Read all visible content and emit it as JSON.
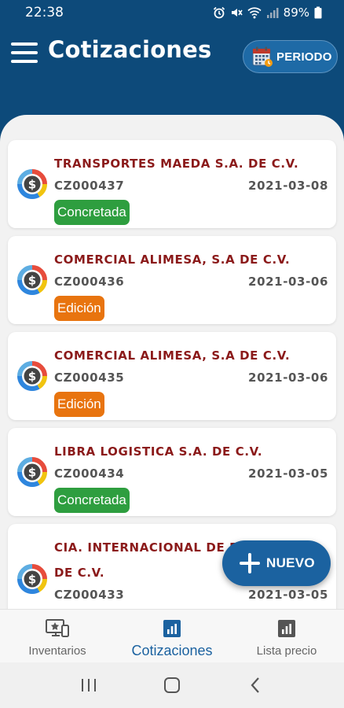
{
  "status_bar": {
    "time": "22:38",
    "battery": "89%"
  },
  "app_bar": {
    "title": "Cotizaciones",
    "periodo_label": "PERIODO"
  },
  "quotes": [
    {
      "name": "TRANSPORTES MAEDA S.A. DE C.V.",
      "code": "CZ000437",
      "date": "2021-03-08",
      "status": "Concretada",
      "status_color": "#2e9e3f"
    },
    {
      "name": "COMERCIAL ALIMESA, S.A DE C.V.",
      "code": "CZ000436",
      "date": "2021-03-06",
      "status": "Edición",
      "status_color": "#e8740f"
    },
    {
      "name": "COMERCIAL ALIMESA, S.A DE C.V.",
      "code": "CZ000435",
      "date": "2021-03-06",
      "status": "Edición",
      "status_color": "#e8740f"
    },
    {
      "name": "LIBRA LOGISTICA S.A. DE C.V.",
      "code": "CZ000434",
      "date": "2021-03-05",
      "status": "Concretada",
      "status_color": "#2e9e3f"
    },
    {
      "name": "CIA. INTERNACIONAL DE FLETES S.A. DE C.V.",
      "code": "CZ000433",
      "date": "2021-03-05",
      "status": "",
      "status_color": ""
    }
  ],
  "fab": {
    "label": "NUEVO"
  },
  "bottom_nav": {
    "items": [
      {
        "label": "Inventarios",
        "icon": "inventory-icon"
      },
      {
        "label": "Cotizaciones",
        "icon": "bar-chart-icon",
        "active": true
      },
      {
        "label": "Lista precio",
        "icon": "price-list-icon"
      }
    ]
  },
  "colors": {
    "primary": "#0d4a7a",
    "accent": "#1b62a0",
    "name_text": "#8b1a1a",
    "concretada": "#2e9e3f",
    "edicion": "#e8740f"
  }
}
